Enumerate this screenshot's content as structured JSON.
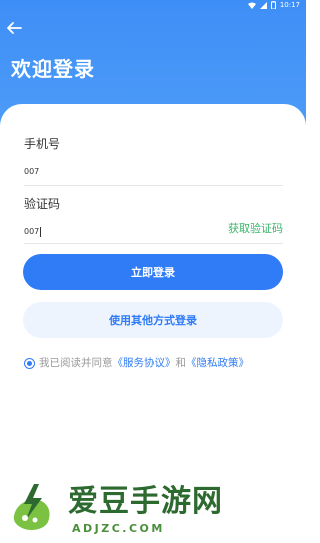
{
  "status_bar": {
    "time": "10:17"
  },
  "header": {
    "title": "欢迎登录",
    "back_icon": "arrow-left-icon"
  },
  "form": {
    "phone": {
      "label": "手机号",
      "value": "007"
    },
    "code": {
      "label": "验证码",
      "value": "007",
      "get_code": "获取验证码"
    }
  },
  "buttons": {
    "login": "立即登录",
    "other_login": "使用其他方式登录"
  },
  "agreement": {
    "prefix": "我已阅读并同意",
    "service": "《服务协议》",
    "and": "和",
    "privacy": "《隐私政策》",
    "checked": true
  },
  "watermark": {
    "name": "爱豆手游网",
    "domain": "ADJZC.COM"
  },
  "colors": {
    "header": "#3e8ef7",
    "primary": "#2f7cf6",
    "secondary_bg": "#eef4fe",
    "get_code": "#3ab36a",
    "watermark": "#2d6a2f"
  }
}
